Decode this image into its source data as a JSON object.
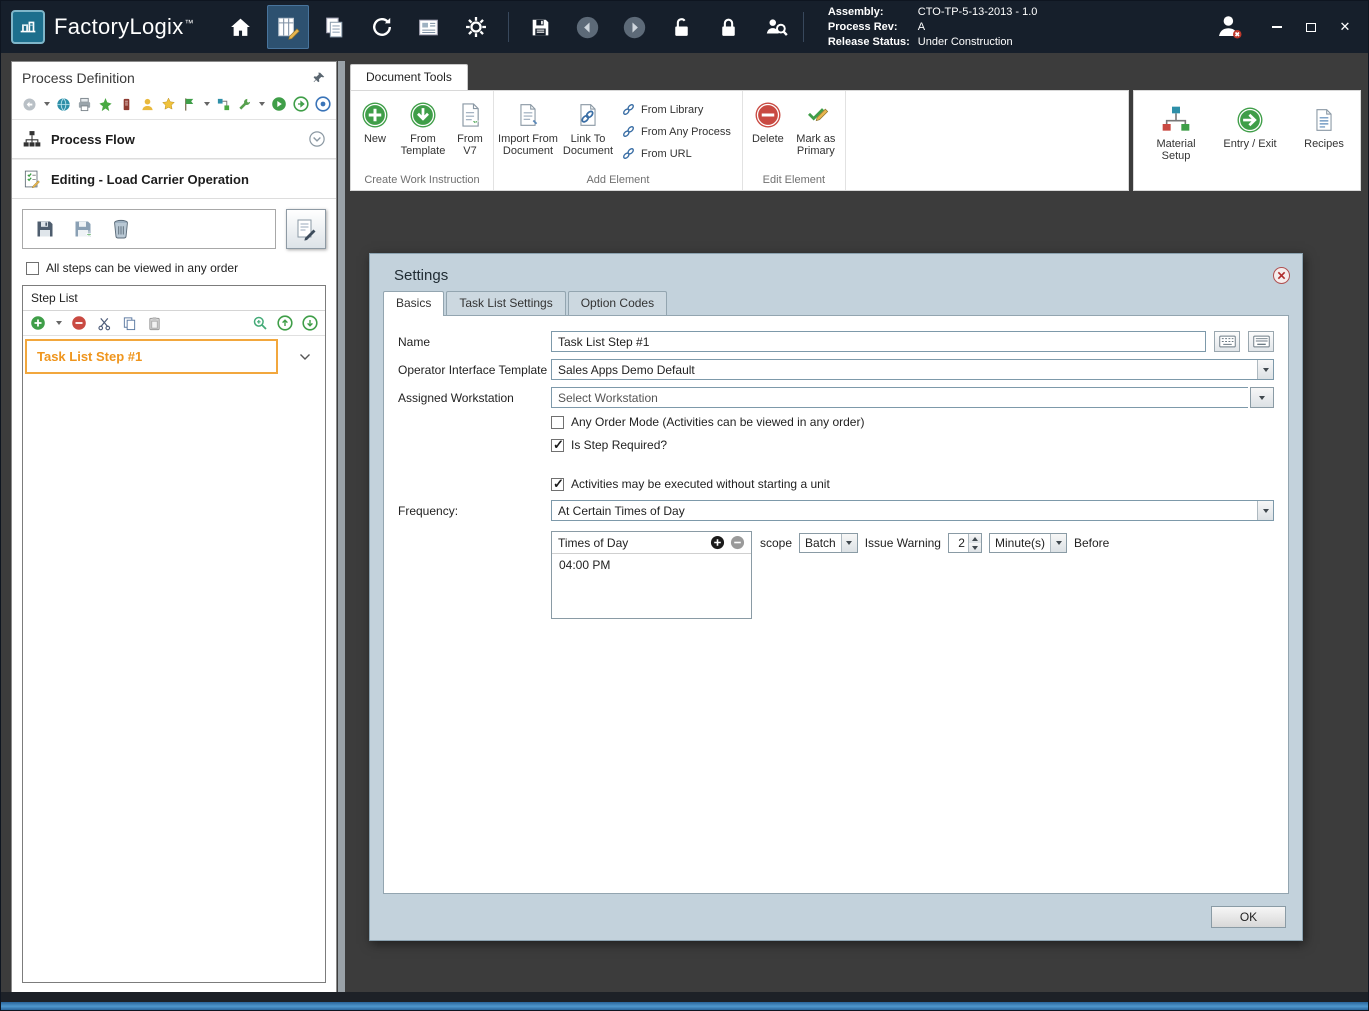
{
  "window": {
    "controls": {
      "close_glyph": "✕"
    }
  },
  "titlebar": {
    "app_name": "FactoryLogix",
    "trademark": "™",
    "info": {
      "assembly_label": "Assembly:",
      "assembly_value": "CTO-TP-5-13-2013 - 1.0",
      "process_rev_label": "Process Rev:",
      "process_rev_value": "A",
      "release_status_label": "Release Status:",
      "release_status_value": "Under Construction"
    }
  },
  "sidebar": {
    "title": "Process Definition",
    "process_flow_label": "Process Flow",
    "editing_label": "Editing - Load Carrier Operation",
    "any_order_checkbox": {
      "label": "All steps can be viewed in any order",
      "checked": "false"
    },
    "step_list": {
      "title": "Step List",
      "items": [
        {
          "label": "Task List Step #1",
          "selected": "true"
        }
      ]
    }
  },
  "ribbon": {
    "tab_label": "Document Tools",
    "groups": {
      "create": {
        "label": "Create Work Instruction",
        "new_label": "New",
        "from_template_label": "From Template",
        "from_v7_label": "From V7"
      },
      "add": {
        "label": "Add Element",
        "import_label": "Import From Document",
        "link_label": "Link To Document",
        "from_library_label": "From Library",
        "from_any_process_label": "From Any Process",
        "from_url_label": "From URL"
      },
      "edit": {
        "label": "Edit Element",
        "delete_label": "Delete",
        "mark_primary_label": "Mark as Primary"
      }
    },
    "right": {
      "material_setup_label": "Material Setup",
      "entry_exit_label": "Entry / Exit",
      "recipes_label": "Recipes"
    }
  },
  "dialog": {
    "title": "Settings",
    "tabs": [
      {
        "label": "Basics"
      },
      {
        "label": "Task List Settings"
      },
      {
        "label": "Option Codes"
      }
    ],
    "fields": {
      "name_label": "Name",
      "name_value": "Task List Step #1",
      "operator_template_label": "Operator Interface Template",
      "operator_template_value": "Sales Apps Demo Default",
      "workstation_label": "Assigned Workstation",
      "workstation_placeholder": "Select Workstation",
      "frequency_label": "Frequency:",
      "frequency_value": "At Certain Times of Day"
    },
    "checkboxes": {
      "any_order": {
        "label": "Any Order Mode (Activities can be viewed in any order)",
        "checked": "false"
      },
      "step_required": {
        "label": "Is Step Required?",
        "checked": "true"
      },
      "no_unit": {
        "label": "Activities may be executed without starting a unit",
        "checked": "true"
      }
    },
    "times_of_day": {
      "header": "Times of Day",
      "items": [
        "04:00 PM"
      ],
      "scope_label": "scope",
      "scope_value": "Batch",
      "issue_warning_label": "Issue Warning",
      "warning_value": "2",
      "warning_unit_value": "Minute(s)",
      "before_label": "Before"
    },
    "ok_label": "OK"
  },
  "colors": {
    "titlebar_bg": "#161f2b",
    "accent_orange": "#ef951d",
    "dialog_bg": "#c3d2dc",
    "main_bg": "#3c3c3c"
  }
}
